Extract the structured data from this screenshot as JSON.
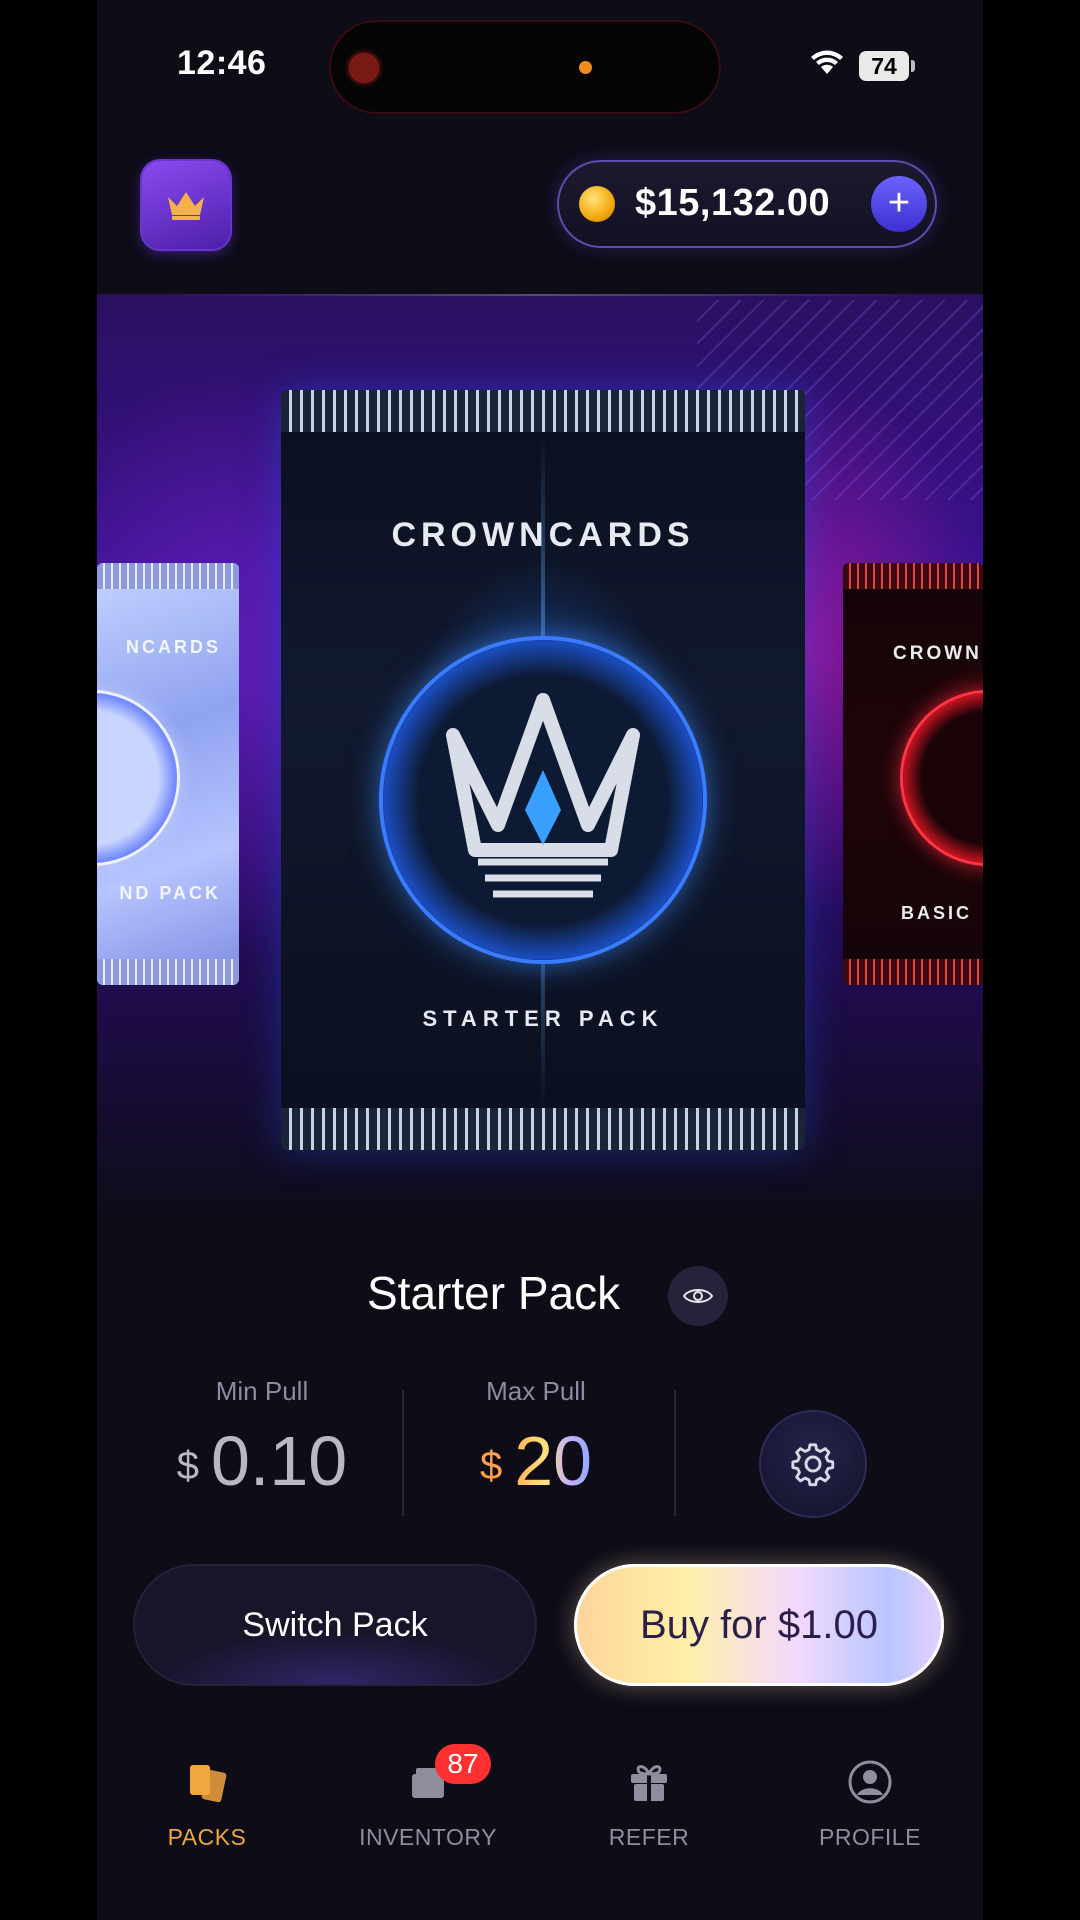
{
  "status_bar": {
    "time": "12:46",
    "battery": "74"
  },
  "header": {
    "balance": "$15,132.00"
  },
  "packs": {
    "left": {
      "brand": "NCARDS",
      "name": "ND PACK"
    },
    "center": {
      "brand": "CROWNCARDS",
      "name": "STARTER PACK"
    },
    "right": {
      "brand": "CROWN",
      "name": "BASIC"
    }
  },
  "selected_pack": {
    "title": "Starter Pack",
    "min_pull": {
      "label": "Min Pull",
      "currency": "$",
      "value": "0.10"
    },
    "max_pull": {
      "label": "Max Pull",
      "currency": "$",
      "value": "20"
    }
  },
  "actions": {
    "switch_label": "Switch Pack",
    "buy_label": "Buy for $1.00"
  },
  "tab_bar": {
    "items": [
      {
        "label": "PACKS",
        "icon": "cards-icon",
        "active": true
      },
      {
        "label": "INVENTORY",
        "icon": "box-icon",
        "badge": "87"
      },
      {
        "label": "REFER",
        "icon": "gift-icon"
      },
      {
        "label": "PROFILE",
        "icon": "user-icon"
      }
    ]
  },
  "colors": {
    "accent": "#f1a640",
    "background": "#0d0c17",
    "primary": "#6c63ff",
    "badge": "#ff3030"
  }
}
